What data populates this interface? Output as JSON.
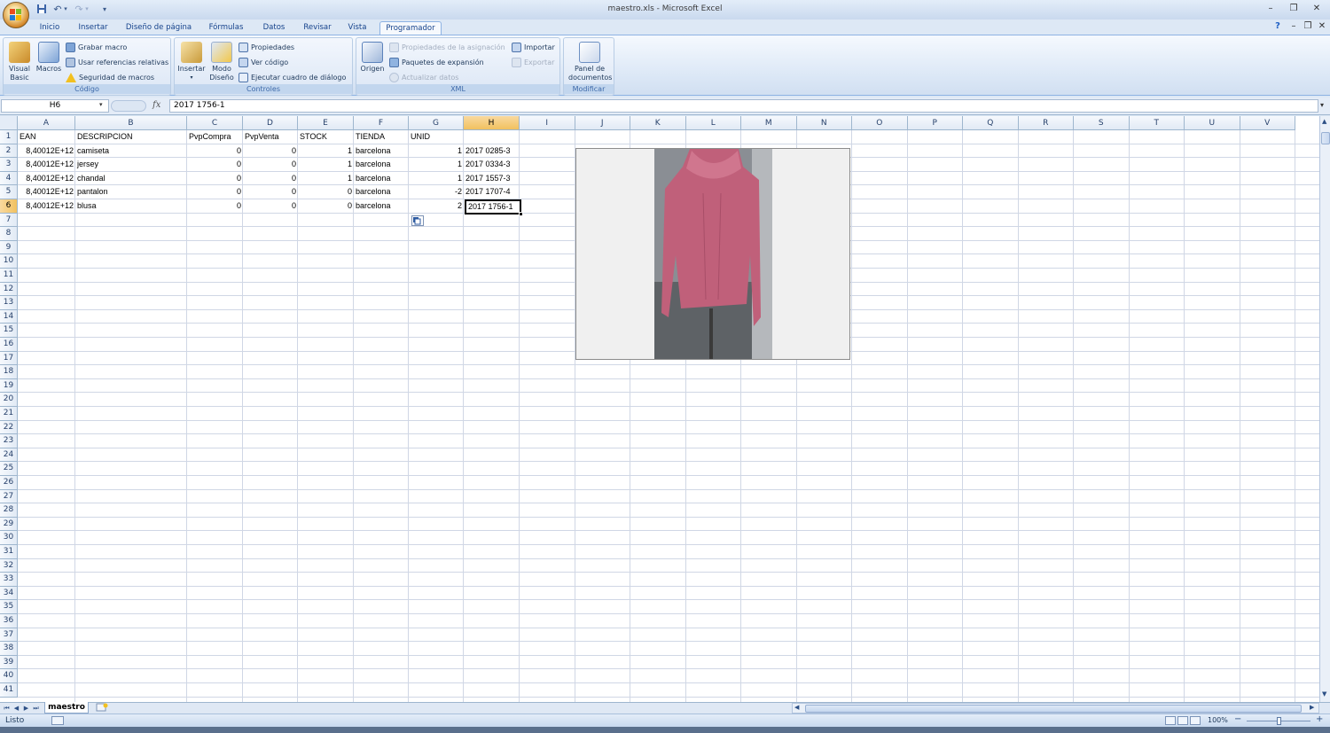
{
  "window": {
    "title": "maestro.xls - Microsoft Excel",
    "controls": [
      "–",
      "❐",
      "✕"
    ],
    "ribbon_controls": [
      "?",
      "–",
      "❐",
      "✕"
    ]
  },
  "quick_access": {
    "save_icon": "save-icon",
    "undo_icon": "undo-icon",
    "redo_icon": "redo-icon",
    "customize": "▾"
  },
  "ribbon": {
    "tabs": [
      "Inicio",
      "Insertar",
      "Diseño de página",
      "Fórmulas",
      "Datos",
      "Revisar",
      "Vista",
      "Programador"
    ],
    "active_tab": "Programador",
    "groups": {
      "codigo": {
        "label": "Código",
        "visual_basic": "Visual Basic",
        "macros": "Macros",
        "grabar_macro": "Grabar macro",
        "usar_referencias": "Usar referencias relativas",
        "seguridad": "Seguridad de macros"
      },
      "controles": {
        "label": "Controles",
        "insertar": "Insertar",
        "modo_diseno": "Modo Diseño",
        "propiedades": "Propiedades",
        "ver_codigo": "Ver código",
        "ejecutar_cuadro": "Ejecutar cuadro de diálogo"
      },
      "xml": {
        "label": "XML",
        "origen": "Origen",
        "propiedades_asignacion": "Propiedades de la asignación",
        "paquetes_expansion": "Paquetes de expansión",
        "actualizar_datos": "Actualizar datos",
        "importar": "Importar",
        "exportar": "Exportar"
      },
      "modificar": {
        "label": "Modificar",
        "panel_documentos": "Panel de documentos"
      }
    }
  },
  "formula_bar": {
    "name_box": "H6",
    "fx": "fx",
    "formula": "2017 1756-1"
  },
  "grid": {
    "columns": [
      "A",
      "B",
      "C",
      "D",
      "E",
      "F",
      "G",
      "H",
      "I",
      "J",
      "K",
      "L",
      "M",
      "N",
      "O",
      "P",
      "Q",
      "R",
      "S",
      "T",
      "U",
      "V"
    ],
    "selected_column": "H",
    "selected_row": 6,
    "rows": [
      "1",
      "2",
      "3",
      "4",
      "5",
      "6",
      "7",
      "8",
      "9",
      "10",
      "11",
      "12",
      "13",
      "14",
      "15",
      "16",
      "17",
      "18",
      "19",
      "20",
      "21",
      "22",
      "23",
      "24",
      "25",
      "26",
      "27",
      "28",
      "29",
      "30",
      "31",
      "32",
      "33",
      "34",
      "35",
      "36",
      "37",
      "38",
      "39",
      "40",
      "41"
    ],
    "header": [
      "EAN",
      "DESCRIPCION",
      "PvpCompra",
      "PvpVenta",
      "STOCK",
      "TIENDA",
      "UNID",
      ""
    ],
    "data": [
      [
        "8,40012E+12",
        "camiseta",
        "0",
        "0",
        "1",
        "barcelona",
        "1",
        "2017 0285-3"
      ],
      [
        "8,40012E+12",
        "jersey",
        "0",
        "0",
        "1",
        "barcelona",
        "1",
        "2017 0334-3"
      ],
      [
        "8,40012E+12",
        "chandal",
        "0",
        "0",
        "1",
        "barcelona",
        "1",
        "2017 1557-3"
      ],
      [
        "8,40012E+12",
        "pantalon",
        "0",
        "0",
        "0",
        "barcelona",
        "-2",
        "2017 1707-4"
      ],
      [
        "8,40012E+12",
        "blusa",
        "0",
        "0",
        "0",
        "barcelona",
        "2",
        "2017 1756-1"
      ]
    ]
  },
  "picture": {
    "subject": "pink turtleneck sweater photo",
    "colors": {
      "sweater": "#c0607a",
      "background": "#f0f0f0"
    }
  },
  "sheet_tabs": {
    "active": "maestro",
    "new_sheet_icon": "insert-sheet-icon"
  },
  "status_bar": {
    "status": "Listo",
    "zoom": "100%",
    "zoom_minus": "−",
    "zoom_plus": "+"
  },
  "colors": {
    "ribbon_accent": "#15428b",
    "selection_header": "#f1c15f",
    "gridline": "#d0d7e5"
  }
}
